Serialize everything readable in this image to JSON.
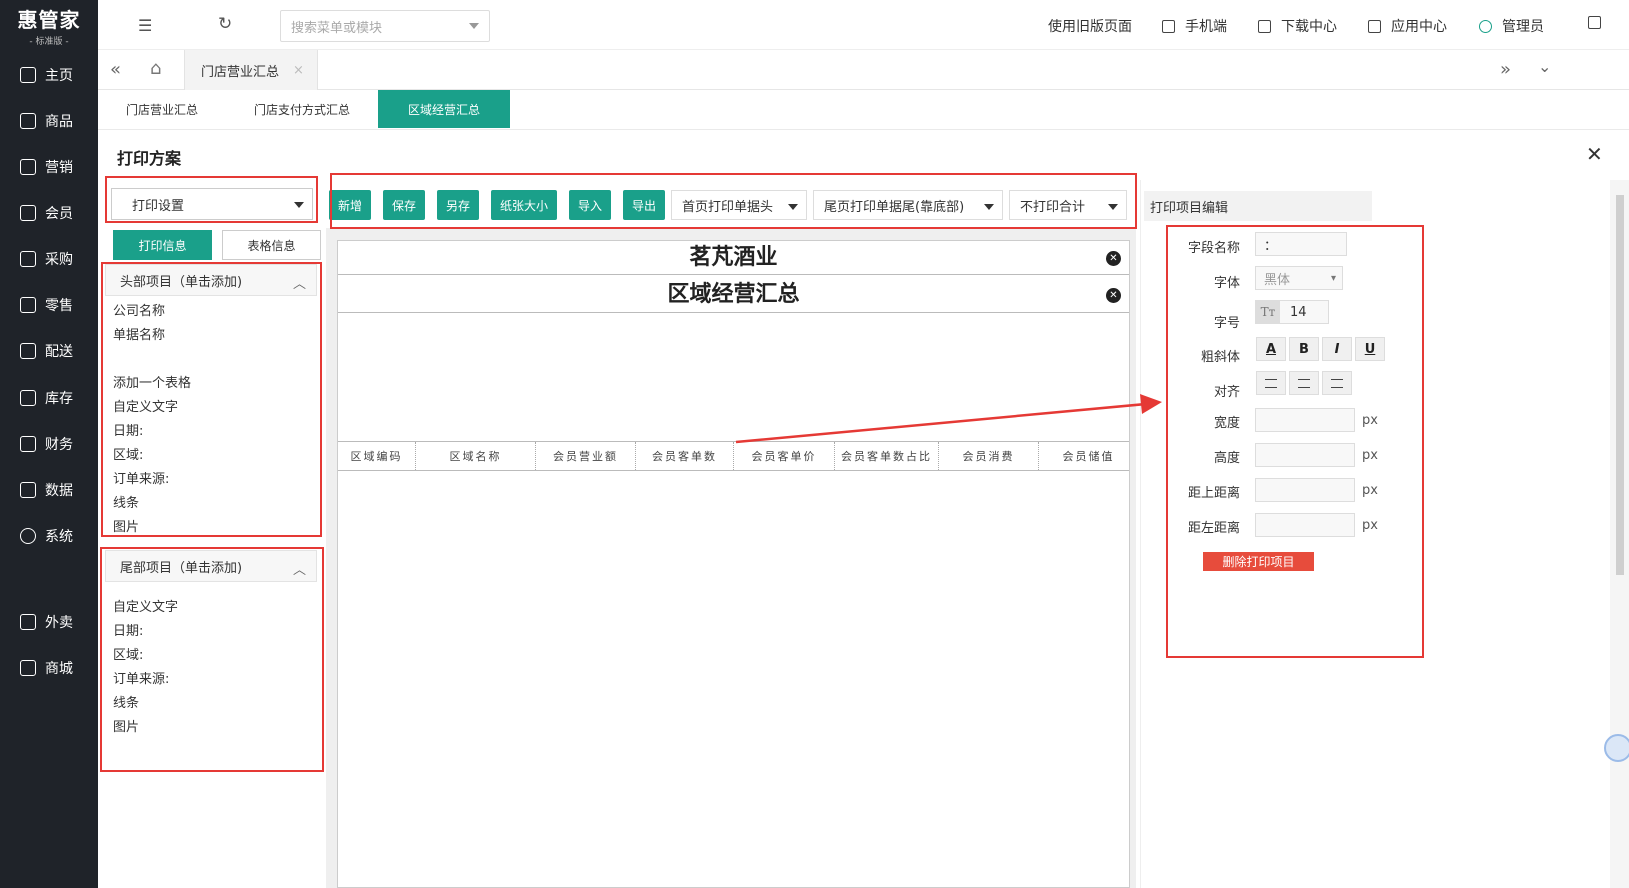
{
  "app": {
    "brand": "惠管家",
    "edition": "- 标准版 -"
  },
  "sidebar": {
    "items": [
      {
        "label": "主页"
      },
      {
        "label": "商品"
      },
      {
        "label": "营销"
      },
      {
        "label": "会员"
      },
      {
        "label": "采购"
      },
      {
        "label": "零售"
      },
      {
        "label": "配送"
      },
      {
        "label": "库存"
      },
      {
        "label": "财务"
      },
      {
        "label": "数据"
      },
      {
        "label": "系统"
      },
      {
        "label": "外卖"
      },
      {
        "label": "商城"
      }
    ]
  },
  "topbar": {
    "search_placeholder": "搜索菜单或模块",
    "old_page": "使用旧版页面",
    "mobile": "手机端",
    "download": "下载中心",
    "apps": "应用中心",
    "user": "管理员"
  },
  "tabs": {
    "current": "门店营业汇总"
  },
  "subtabs": [
    {
      "label": "门店营业汇总",
      "active": false
    },
    {
      "label": "门店支付方式汇总",
      "active": false
    },
    {
      "label": "区域经营汇总",
      "active": true
    }
  ],
  "dialog": {
    "title": "打印方案",
    "print_settings": "打印设置",
    "toolbar": {
      "new": "新增",
      "save": "保存",
      "save_as": "另存",
      "paper": "纸张大小",
      "import": "导入",
      "export": "导出",
      "header_dd": "首页打印单据头",
      "footer_dd": "尾页打印单据尾(靠底部)",
      "total_dd": "不打印合计"
    },
    "info_tabs": {
      "print_info": "打印信息",
      "table_info": "表格信息"
    },
    "head_panel": {
      "title": "头部项目（单击添加)",
      "items": [
        "公司名称",
        "单据名称",
        "",
        "添加一个表格",
        "自定义文字",
        "日期:",
        "区域:",
        "订单来源:",
        "线条",
        "图片"
      ]
    },
    "foot_panel": {
      "title": "尾部项目（单击添加)",
      "items": [
        "自定义文字",
        "日期:",
        "区域:",
        "订单来源:",
        "线条",
        "图片"
      ]
    },
    "canvas": {
      "company": "茗芃酒业",
      "doc_title": "区域经营汇总",
      "columns": [
        "区域编码",
        "区域名称",
        "会员营业额",
        "会员客单数",
        "会员客单价",
        "会员客单数占比",
        "会员消费",
        "会员储值"
      ]
    },
    "edit": {
      "title": "打印项目编辑",
      "field_name_label": "字段名称",
      "field_name_value": "：",
      "font_label": "字体",
      "font_value": "黑体",
      "size_label": "字号",
      "size_value": "14",
      "style_label": "粗斜体",
      "style_a": "A",
      "style_b": "B",
      "style_i": "I",
      "style_u": "U",
      "align_label": "对齐",
      "width_label": "宽度",
      "height_label": "高度",
      "top_label": "距上距离",
      "left_label": "距左距离",
      "unit": "px",
      "delete": "删除打印项目"
    }
  },
  "colors": {
    "accent": "#1aa08a",
    "sidebar": "#1f2329",
    "danger": "#e74c3c",
    "annotation": "#e53935"
  }
}
